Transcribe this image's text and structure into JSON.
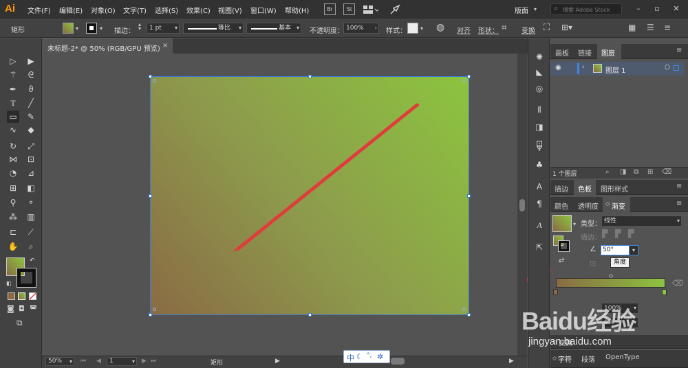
{
  "app": {
    "logo": "Ai"
  },
  "menu": {
    "items": [
      "文件(F)",
      "编辑(E)",
      "对象(O)",
      "文字(T)",
      "选择(S)",
      "效果(C)",
      "视图(V)",
      "窗口(W)",
      "帮助(H)"
    ],
    "bridge": "Br",
    "stock": "St",
    "workspace": "版面",
    "search_placeholder": "搜索 Adobe Stock"
  },
  "control": {
    "object_type": "矩形",
    "stroke_label": "描边：",
    "stroke_weight": "1 pt",
    "profile_label": "等比",
    "brush_label": "基本",
    "opacity_label": "不透明度：",
    "opacity_value": "100%",
    "style_label": "样式：",
    "align_label": "对齐",
    "shape_label": "形状：",
    "transform_label": "变换"
  },
  "document": {
    "tab_title": "未标题-2* @ 50% (RGB/GPU 预览)",
    "close_glyph": "×"
  },
  "status": {
    "zoom": "50%",
    "page": "1",
    "tool_name": "矩形"
  },
  "layers_panel": {
    "tabs": [
      "画板",
      "链接",
      "图层"
    ],
    "active_tab": "图层",
    "layer_name": "图层 1",
    "footer_count": "1 个图层"
  },
  "color_panel_group": {
    "tabs": [
      "描边",
      "色板",
      "图形样式"
    ],
    "active_tab": "色板"
  },
  "gradient_panel": {
    "tabs": [
      "颜色",
      "透明度",
      "渐变"
    ],
    "active_tab": "渐变",
    "type_label": "类型：",
    "type_value": "线性",
    "stroke_label": "描边：",
    "angle_value": "50°",
    "angle_tooltip": "角度",
    "opacity_value_1": "100%",
    "opacity_value_2": "0%",
    "start_color": "#8a6b44",
    "end_color": "#8cc43f"
  },
  "transform_panel": {
    "title": "变换"
  },
  "type_panel": {
    "tabs": [
      "字符",
      "段落",
      "OpenType"
    ],
    "active_tab": "字符"
  },
  "ime": {
    "lang": "中",
    "moon": "☾",
    "punct": "°,",
    "gear": "✲"
  },
  "watermark": {
    "brand_text": "Baidu经验",
    "url": "jingyan.baidu.com"
  },
  "colors": {
    "accent": "#3b88e0",
    "arrow": "#e03c3c",
    "logo": "#ff9a00"
  }
}
